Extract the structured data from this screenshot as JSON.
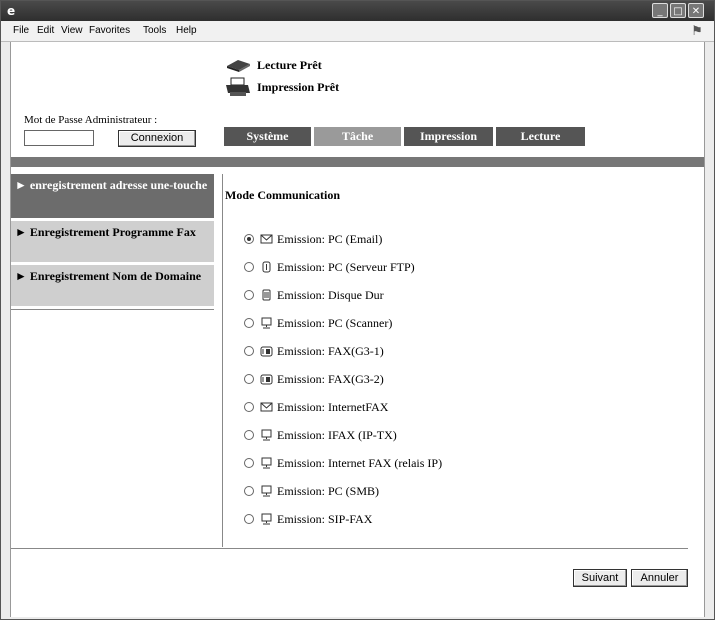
{
  "menu": [
    "File",
    "Edit",
    "View",
    "Favorites",
    "Tools",
    "Help"
  ],
  "status": {
    "lecture": "Lecture Prêt",
    "impression": "Impression Prêt"
  },
  "admin": {
    "label": "Mot de Passe Administrateur :",
    "password_value": "",
    "login_button": "Connexion"
  },
  "tabs": [
    {
      "label": "Système",
      "selected": false
    },
    {
      "label": "Tâche",
      "selected": true
    },
    {
      "label": "Impression",
      "selected": false
    },
    {
      "label": "Lecture",
      "selected": false
    }
  ],
  "sidebar": [
    {
      "label": "► enregistrement adresse une-touche",
      "selected": true
    },
    {
      "label": "► Enregistrement Programme Fax",
      "selected": false
    },
    {
      "label": "► Enregistrement Nom de Domaine",
      "selected": false
    }
  ],
  "main": {
    "title": "Mode Communication",
    "options": [
      {
        "label": "Emission: PC (Email)",
        "icon": "email-icon",
        "checked": true
      },
      {
        "label": "Emission: PC (Serveur FTP)",
        "icon": "ftp-icon",
        "checked": false
      },
      {
        "label": "Emission: Disque Dur",
        "icon": "hdd-icon",
        "checked": false
      },
      {
        "label": "Emission: PC (Scanner)",
        "icon": "pc-icon",
        "checked": false
      },
      {
        "label": "Emission: FAX(G3-1)",
        "icon": "fax-icon",
        "checked": false
      },
      {
        "label": "Emission: FAX(G3-2)",
        "icon": "fax-icon",
        "checked": false
      },
      {
        "label": "Emission: InternetFAX",
        "icon": "email-icon",
        "checked": false
      },
      {
        "label": "Emission: IFAX (IP-TX)",
        "icon": "pc-icon",
        "checked": false
      },
      {
        "label": "Emission: Internet FAX (relais IP)",
        "icon": "pc-icon",
        "checked": false
      },
      {
        "label": "Emission: PC (SMB)",
        "icon": "pc-icon",
        "checked": false
      },
      {
        "label": "Emission: SIP-FAX",
        "icon": "pc-icon",
        "checked": false
      }
    ]
  },
  "footer": {
    "next": "Suivant",
    "cancel": "Annuler"
  }
}
